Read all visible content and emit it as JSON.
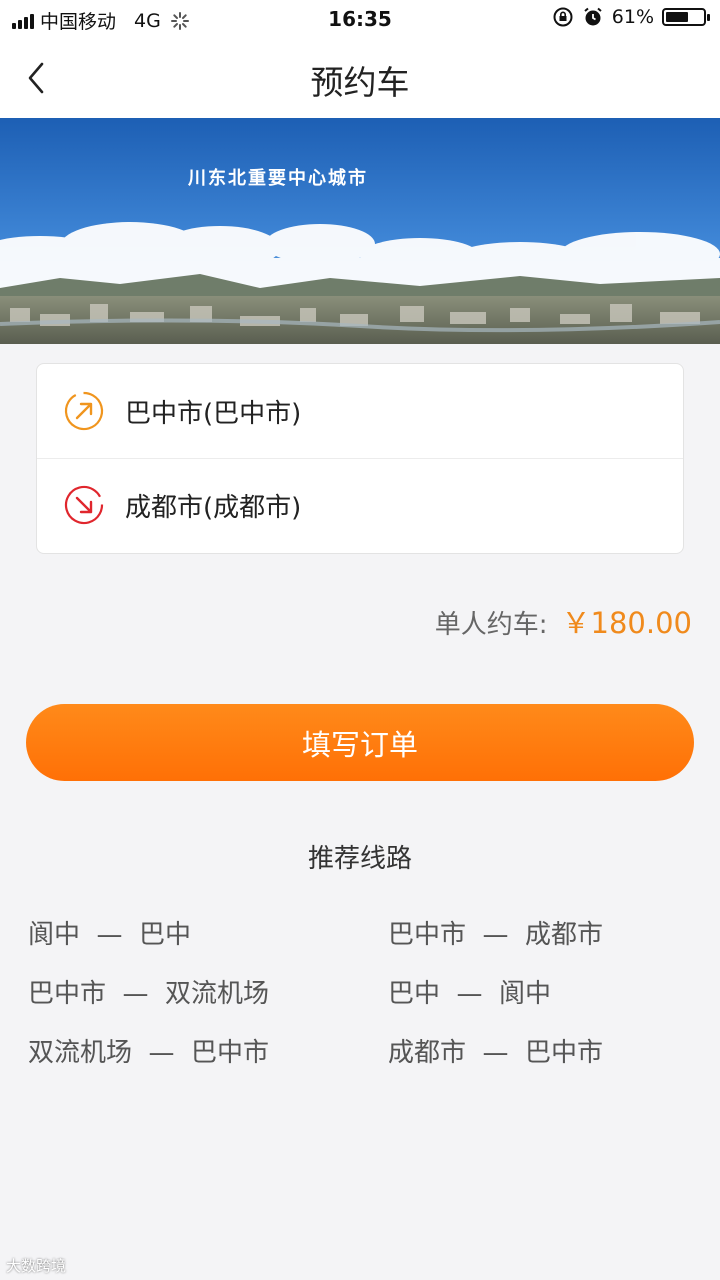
{
  "status_bar": {
    "carrier": "中国移动",
    "network": "4G",
    "time": "16:35",
    "battery_text": "61%",
    "battery_level": 0.61
  },
  "header": {
    "title": "预约车",
    "back_icon": "chevron-left-icon"
  },
  "banner": {
    "caption": "川东北重要中心城市"
  },
  "route": {
    "start": "巴中市(巴中市)",
    "end": "成都市(成都市)",
    "start_icon": "arrow-up-right-icon",
    "end_icon": "arrow-down-right-icon",
    "start_color": "#f0951e",
    "end_color": "#e0262d"
  },
  "price": {
    "label": "单人约车:",
    "value": "￥180.00",
    "color": "#f08a1c"
  },
  "order_button": {
    "label": "填写订单",
    "color": "#ff7a0d"
  },
  "recommended": {
    "title": "推荐线路",
    "routes": [
      "阆中  —  巴中",
      "巴中市  —  成都市",
      "巴中市  —  双流机场",
      "巴中  —  阆中",
      "双流机场  —  巴中市",
      "成都市  —  巴中市"
    ]
  },
  "watermark": "大数跨境"
}
